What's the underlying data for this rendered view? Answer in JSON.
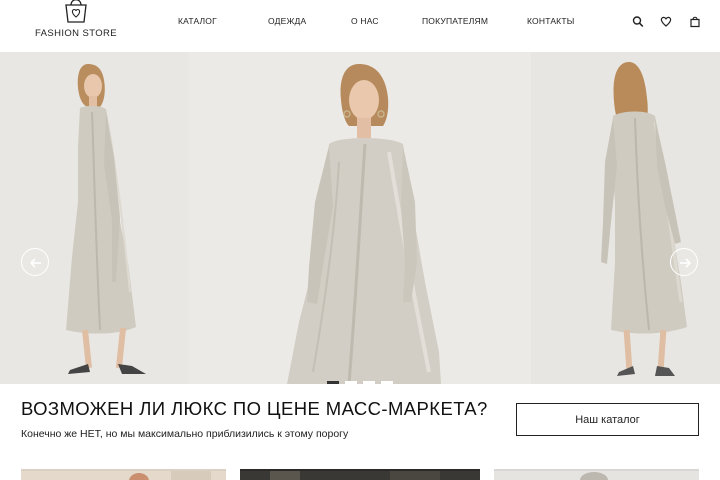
{
  "header": {
    "logo_text": "FASHION STORE",
    "nav": [
      {
        "label": "КАТАЛОГ"
      },
      {
        "label": "ОДЕЖДА"
      },
      {
        "label": "О НАС"
      },
      {
        "label": "ПОКУПАТЕЛЯМ"
      },
      {
        "label": "КОНТАКТЫ"
      }
    ],
    "icons": [
      "search-icon",
      "heart-icon",
      "shopping-bag-icon"
    ]
  },
  "hero": {
    "slides_total": 4,
    "active_slide": 1,
    "prev_icon": "arrow-left-icon",
    "next_icon": "arrow-right-icon"
  },
  "promo": {
    "headline": "ВОЗМОЖЕН ЛИ ЛЮКС ПО ЦЕНЕ МАСС-МАРКЕТА?",
    "subline": "Конечно же НЕТ, но мы максимально приблизились к этому порогу",
    "button_label": "Наш каталог"
  },
  "colors": {
    "text": "#1a1a1a",
    "background": "#ffffff",
    "hero_bg": "#ecebe7",
    "dress": "#cfcbc2"
  }
}
